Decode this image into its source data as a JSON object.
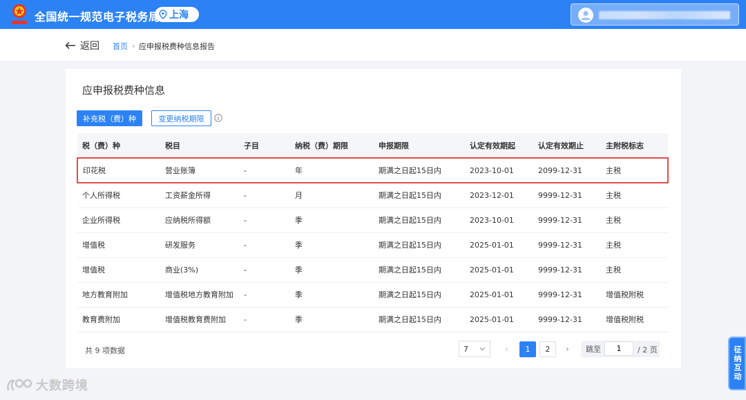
{
  "header": {
    "site_title": "全国统一规范电子税务局",
    "region": "上海"
  },
  "subbar": {
    "back_label": "返回",
    "breadcrumb": [
      "首页",
      "应申报税费种信息报告"
    ]
  },
  "main": {
    "title": "应申报税费种信息",
    "buttons": {
      "supplement": "补充税（费）种",
      "change_period": "变更纳税期限"
    },
    "table": {
      "columns": [
        "税（费）种",
        "税目",
        "子目",
        "纳税（费）期限",
        "申报期限",
        "认定有效期起",
        "认定有效期止",
        "主附税标志"
      ],
      "rows": [
        [
          "印花税",
          "营业账簿",
          "-",
          "年",
          "期满之日起15日内",
          "2023-10-01",
          "2099-12-31",
          "主税"
        ],
        [
          "个人所得税",
          "工资薪金所得",
          "-",
          "月",
          "期满之日起15日内",
          "2023-12-01",
          "9999-12-31",
          "主税"
        ],
        [
          "企业所得税",
          "应纳税所得额",
          "-",
          "季",
          "期满之日起15日内",
          "2023-10-01",
          "9999-12-31",
          "主税"
        ],
        [
          "增值税",
          "研发服务",
          "-",
          "季",
          "期满之日起15日内",
          "2025-01-01",
          "9999-12-31",
          "主税"
        ],
        [
          "增值税",
          "商业(3%)",
          "-",
          "季",
          "期满之日起15日内",
          "2025-01-01",
          "9999-12-31",
          "主税"
        ],
        [
          "地方教育附加",
          "增值税地方教育附加",
          "-",
          "季",
          "期满之日起15日内",
          "2025-01-01",
          "9999-12-31",
          "增值税附税"
        ],
        [
          "教育费附加",
          "增值税教育费附加",
          "-",
          "季",
          "期满之日起15日内",
          "2025-01-01",
          "9999-12-31",
          "增值税附税"
        ]
      ]
    },
    "pagination": {
      "total_text": "共 9 项数据",
      "page_size": "7",
      "pages": [
        "1",
        "2"
      ],
      "jump_label": "跳至",
      "jump_value": "1",
      "jump_suffix": "/ 2 页"
    }
  },
  "side_widget": {
    "label": "征纳互动"
  },
  "watermark": {
    "text": "大数跨境"
  },
  "colors": {
    "primary": "#2c82f5",
    "highlight_border": "#e34b4b"
  }
}
